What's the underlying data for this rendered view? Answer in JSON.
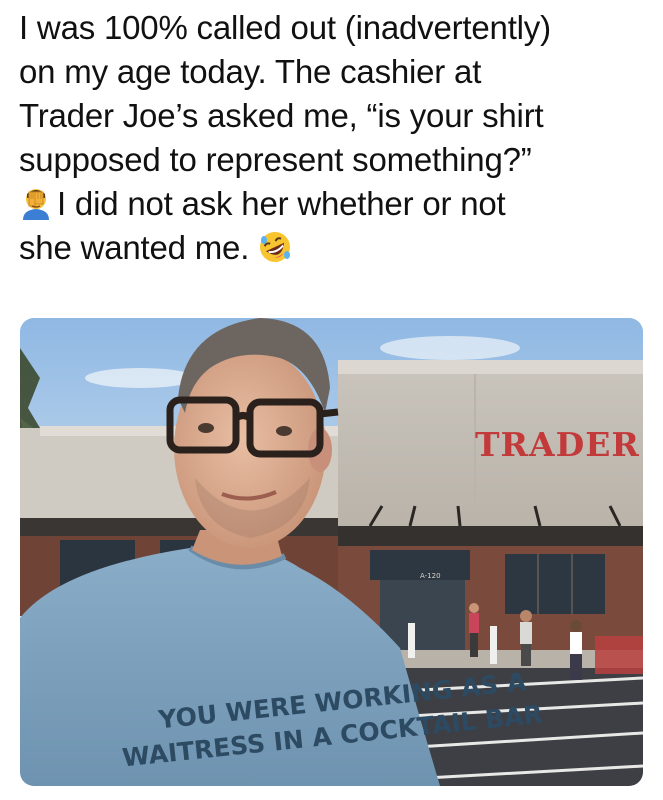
{
  "post": {
    "line1": "I was 100% called out (inadvertently)",
    "line2": "on my age today. The cashier at",
    "line3": "Trader Joe’s asked me, “is your shirt",
    "line4": "supposed to represent something?”",
    "line5": "I did not ask her whether or not",
    "line6_text": "she wanted me."
  },
  "emoji": {
    "facepalm": "facepalm-emoji-icon",
    "laughing": "rolling-on-floor-laughing-emoji-icon"
  },
  "photo": {
    "store_sign": "TRADER",
    "shirt_line1": "YOU WERE WORKING AS A",
    "shirt_line2": "WAITRESS IN A COCKTAIL BAR",
    "door_number": "A-120"
  },
  "colors": {
    "sky": "#a9c9ea",
    "sign_red": "#c23a3a",
    "shirt_blue": "#7fa3bf",
    "brick": "#7a4a3c",
    "asphalt": "#3d3f44"
  }
}
